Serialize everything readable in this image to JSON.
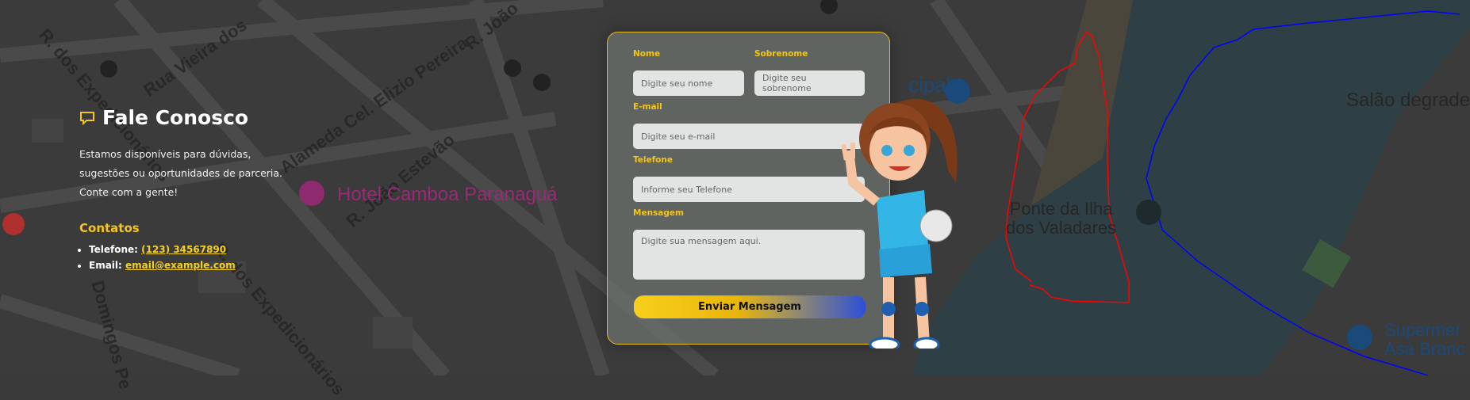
{
  "map": {
    "streets": [
      "Rua Vieira dos",
      "Alameda Cel. Elizio Pereira",
      "R. João Estevão",
      "R. dos Expedicionários",
      "R. dos Expedicionários",
      "Domingos Pe",
      "R. João"
    ],
    "pois": {
      "hotel": "Hotel Camboa Paranaguá",
      "bridge_line1": "Ponte da Ilha",
      "bridge_line2": "dos Valadares",
      "salon": "Salão degrade",
      "market_line1": "Supermer",
      "market_line2": "Asa Branc",
      "municipal": "cipal"
    },
    "colors": {
      "water": "#2e4046",
      "land": "#3b3b3b",
      "red_drawing": "#ff0000",
      "blue_drawing": "#0000ff"
    }
  },
  "info": {
    "title": "Fale Conosco",
    "description": "Estamos disponíveis para dúvidas, sugestões ou oportunidades de parceria. Conte com a gente!",
    "contacts_title": "Contatos",
    "phone_label": "Telefone:",
    "phone": "(123) 34567890",
    "email_label": "Email:",
    "email": "email@example.com"
  },
  "form": {
    "first_name_label": "Nome",
    "first_name_placeholder": "Digite seu nome",
    "last_name_label": "Sobrenome",
    "last_name_placeholder": "Digite seu sobrenome",
    "email_label": "E-mail",
    "email_placeholder": "Digite seu e-mail",
    "phone_label": "Telefone",
    "phone_placeholder": "Informe seu Telefone",
    "message_label": "Mensagem",
    "message_placeholder": "Digite sua mensagem aqui.",
    "submit_label": "Enviar Mensagem"
  },
  "accent": "#f5c518"
}
